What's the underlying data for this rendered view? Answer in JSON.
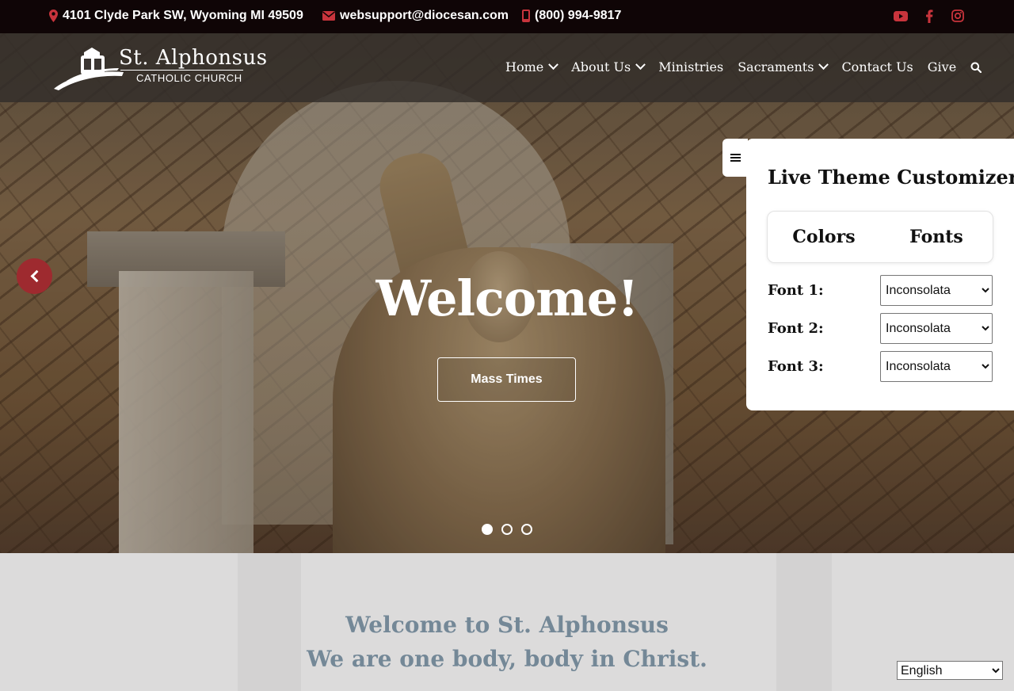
{
  "topbar": {
    "address": "4101 Clyde Park SW, Wyoming MI 49509",
    "email": "websupport@diocesan.com",
    "phone": "(800) 994-9817",
    "icons": [
      "map-marker-icon",
      "envelope-icon",
      "mobile-phone-icon"
    ],
    "social": [
      "youtube-icon",
      "facebook-icon",
      "instagram-icon"
    ],
    "accent_color": "#c8343c"
  },
  "logo": {
    "title": "St. Alphonsus",
    "subtitle": "CATHOLIC CHURCH"
  },
  "nav": {
    "items": [
      {
        "label": "Home",
        "dropdown": true
      },
      {
        "label": "About Us",
        "dropdown": true
      },
      {
        "label": "Ministries",
        "dropdown": false
      },
      {
        "label": "Sacraments",
        "dropdown": true
      },
      {
        "label": "Contact Us",
        "dropdown": false
      },
      {
        "label": "Give",
        "dropdown": false
      }
    ],
    "search_icon": "search-icon"
  },
  "hero": {
    "heading": "Welcome!",
    "button_label": "Mass Times",
    "slides_total": 3,
    "active_slide": 1,
    "prev_color": "#9e2a2f"
  },
  "customizer": {
    "title": "Live Theme Customizer",
    "tabs": [
      "Colors",
      "Fonts"
    ],
    "font_rows": [
      {
        "label": "Font 1:",
        "value": "Inconsolata"
      },
      {
        "label": "Font 2:",
        "value": "Inconsolata"
      },
      {
        "label": "Font 3:",
        "value": "Inconsolata"
      }
    ]
  },
  "intro": {
    "line1": "Welcome to St. Alphonsus",
    "line2": "We are one body, body in Christ.",
    "text_color": "#748897"
  },
  "language": {
    "selected": "English"
  }
}
